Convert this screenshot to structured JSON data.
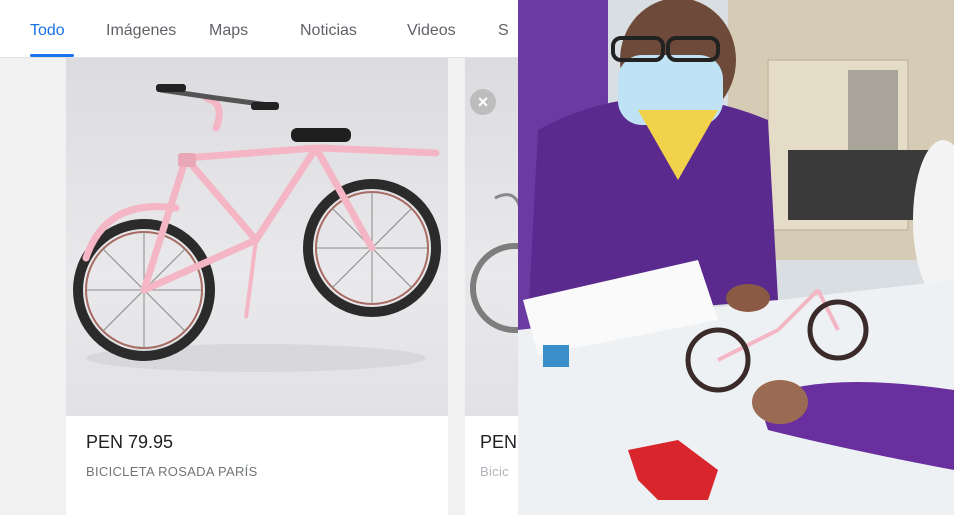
{
  "tabs": [
    {
      "label": "Todo",
      "active": true
    },
    {
      "label": "Imágenes",
      "active": false
    },
    {
      "label": "Maps",
      "active": false
    },
    {
      "label": "Noticias",
      "active": false
    },
    {
      "label": "Videos",
      "active": false
    },
    {
      "label": "S",
      "active": false
    }
  ],
  "results": [
    {
      "price": "PEN 79.95",
      "title": "BICICLETA ROSADA PARÍS"
    },
    {
      "price": "PEN",
      "title": "Bicic"
    }
  ],
  "close_icon": "close-icon",
  "colors": {
    "accent": "#1a73e8",
    "bike": "#f4b6c4",
    "uniform": "#5b2a8f"
  }
}
